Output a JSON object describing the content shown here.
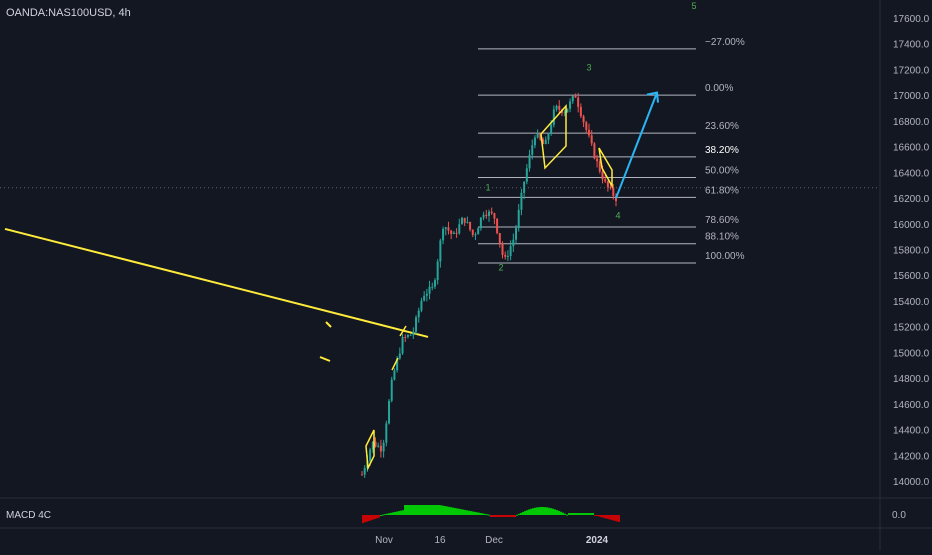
{
  "symbol_title": "OANDA:NAS100USD, 4h",
  "indicator": {
    "name": "MACD 4C",
    "value": "0.0"
  },
  "chart_data": {
    "type": "line",
    "x_ticks": [
      "Nov",
      "16",
      "Dec",
      "2024"
    ],
    "ylim": [
      13900,
      17750
    ],
    "y_ticks": [
      14000,
      14200,
      14400,
      14600,
      14800,
      15000,
      15200,
      15400,
      15600,
      15800,
      16000,
      16200,
      16400,
      16600,
      16800,
      17000,
      17200,
      17400,
      17600
    ],
    "y_tick_labels": [
      "14000.0",
      "14200.0",
      "14400.0",
      "14600.0",
      "14800.0",
      "15000.0",
      "15200.0",
      "15400.0",
      "15600.0",
      "15800.0",
      "16000.0",
      "16200.0",
      "16400.0",
      "16600.0",
      "16800.0",
      "17000.0",
      "17200.0",
      "17400.0",
      "17600.0"
    ],
    "fib_levels": [
      {
        "label": "−27.00%",
        "price": 17360
      },
      {
        "label": "0.00%",
        "price": 17000
      },
      {
        "label": "23.60%",
        "price": 16705
      },
      {
        "label": "38.20%",
        "price": 16520
      },
      {
        "label": "50.00%",
        "price": 16360
      },
      {
        "label": "61.80%",
        "price": 16205
      },
      {
        "label": "78.60%",
        "price": 15975
      },
      {
        "label": "88.10%",
        "price": 15845
      },
      {
        "label": "100.00%",
        "price": 15695
      }
    ],
    "wave_labels": [
      {
        "label": "1",
        "price": 16260
      },
      {
        "label": "2",
        "price": 15635
      },
      {
        "label": "3",
        "price": 17190
      },
      {
        "label": "4",
        "price": 16040
      },
      {
        "label": "5",
        "price": 17670
      }
    ],
    "crosshair_price": 16280,
    "price_path": [
      14050,
      14300,
      14250,
      14800,
      15100,
      15150,
      15450,
      15500,
      16000,
      15900,
      16050,
      15900,
      16100,
      16060,
      15700,
      15900,
      16350,
      16700,
      16600,
      16900,
      16880,
      17000,
      16750,
      16500,
      16300,
      16200
    ],
    "projection": [
      16200,
      17020
    ],
    "trendline": [
      15960,
      15120
    ],
    "colors": {
      "up": "#26a69a",
      "down": "#ef5350",
      "fib": "#b2b5be",
      "wave": "#4caf50",
      "trend": "#ffeb3b",
      "arrow": "#29b6f6"
    }
  }
}
